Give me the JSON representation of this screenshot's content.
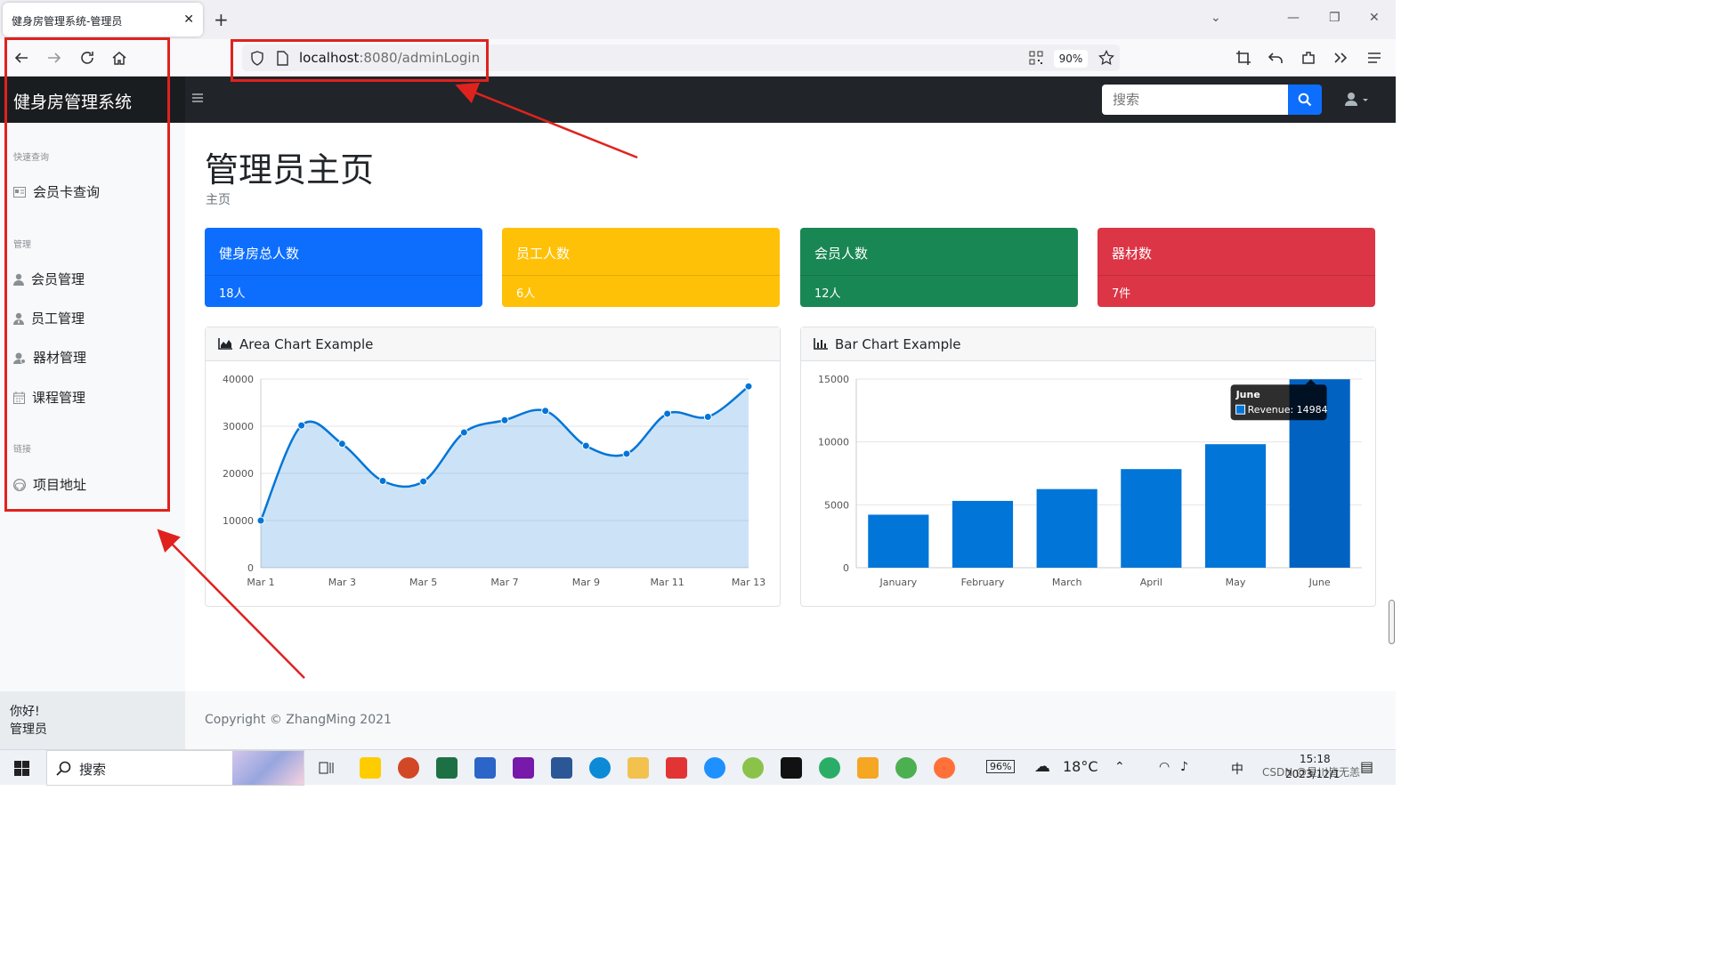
{
  "browser": {
    "tab_title": "健身房管理系统-管理员",
    "tab_close": "✕",
    "new_tab": "+",
    "url_host": "localhost",
    "url_path": ":8080/adminLogin",
    "zoom": "90%"
  },
  "app": {
    "brand": "健身房管理系统",
    "search_placeholder": "搜索"
  },
  "sidebar": {
    "section_quick": "快速查询",
    "item_card": "会员卡查询",
    "section_manage": "管理",
    "item_members": "会员管理",
    "item_staff": "员工管理",
    "item_equipment": "器材管理",
    "item_courses": "课程管理",
    "section_links": "链接",
    "item_project": "项目地址",
    "greeting": "你好!",
    "role": "管理员"
  },
  "main": {
    "title": "管理员主页",
    "breadcrumb": "主页",
    "cards": [
      {
        "label": "健身房总人数",
        "value": "18人",
        "color": "#0d6efd"
      },
      {
        "label": "员工人数",
        "value": "6人",
        "color": "#ffc107"
      },
      {
        "label": "会员人数",
        "value": "12人",
        "color": "#198754"
      },
      {
        "label": "器材数",
        "value": "7件",
        "color": "#dc3545"
      }
    ],
    "footer": "Copyright © ZhangMing 2021"
  },
  "chart_data": [
    {
      "type": "area",
      "title": "Area Chart Example",
      "x": [
        "Mar 1",
        "Mar 2",
        "Mar 3",
        "Mar 4",
        "Mar 5",
        "Mar 6",
        "Mar 7",
        "Mar 8",
        "Mar 9",
        "Mar 10",
        "Mar 11",
        "Mar 12",
        "Mar 13"
      ],
      "x_tick_labels": [
        "Mar 1",
        "Mar 3",
        "Mar 5",
        "Mar 7",
        "Mar 9",
        "Mar 11",
        "Mar 13"
      ],
      "values": [
        10000,
        30162,
        26263,
        18394,
        18287,
        28682,
        31274,
        33259,
        25849,
        24159,
        32651,
        31984,
        38451
      ],
      "ylim": [
        0,
        40000
      ],
      "yticks": [
        0,
        10000,
        20000,
        30000,
        40000
      ],
      "color": "#0275d8"
    },
    {
      "type": "bar",
      "title": "Bar Chart Example",
      "categories": [
        "January",
        "February",
        "March",
        "April",
        "May",
        "June"
      ],
      "values": [
        4215,
        5312,
        6251,
        7841,
        9821,
        14984
      ],
      "ylim": [
        0,
        15000
      ],
      "yticks": [
        0,
        5000,
        10000,
        15000
      ],
      "color": "#0275d8",
      "tooltip": {
        "title": "June",
        "label": "Revenue: 14984"
      }
    }
  ],
  "taskbar": {
    "search": "搜索",
    "battery": "96%",
    "temp": "18°C",
    "time": "15:18",
    "date": "2023/12/1",
    "watermark": "CSDN @星川皆无恙"
  }
}
